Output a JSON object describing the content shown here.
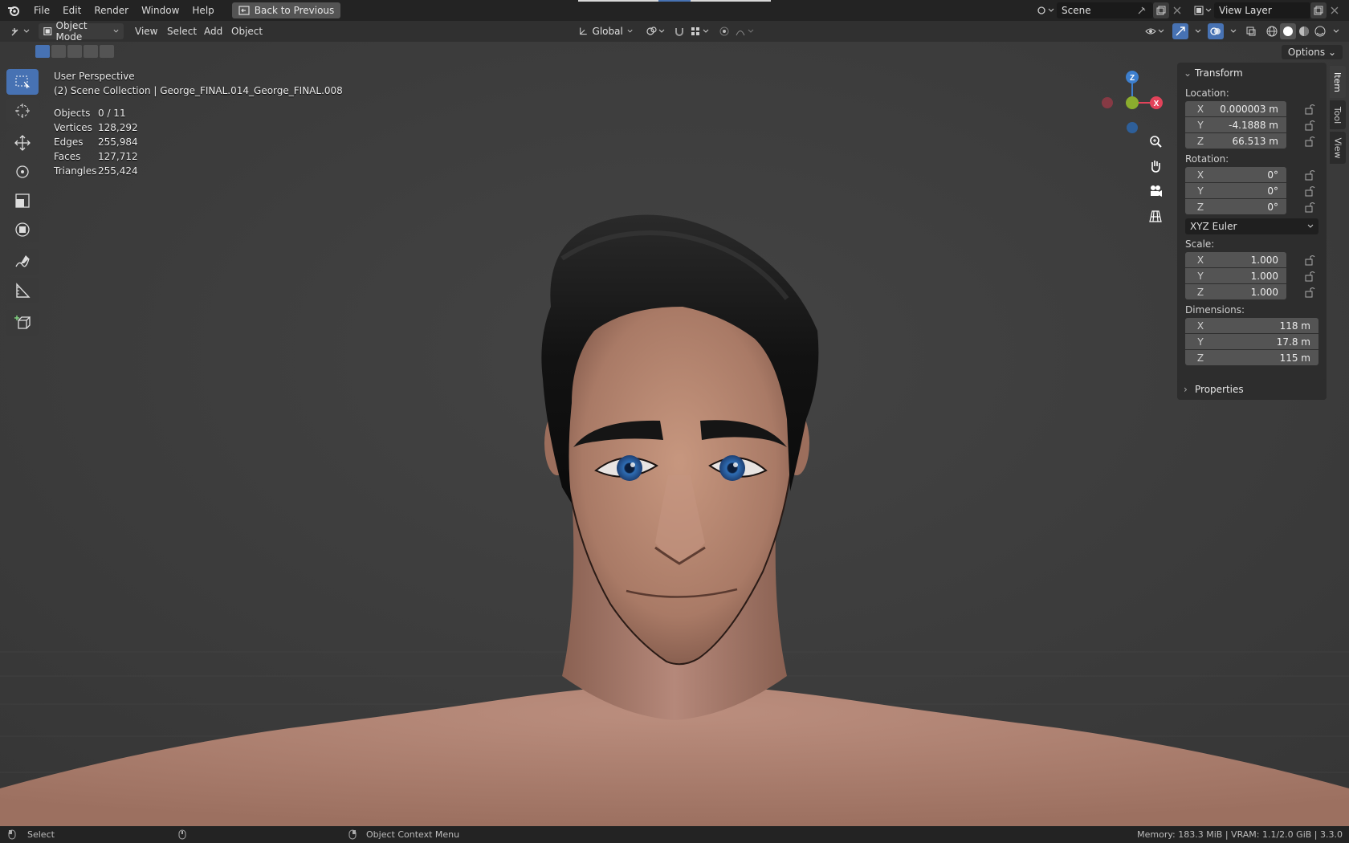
{
  "menubar": {
    "items": [
      "File",
      "Edit",
      "Render",
      "Window",
      "Help"
    ],
    "back_label": "Back to Previous",
    "scene_name": "Scene",
    "view_layer": "View Layer"
  },
  "header": {
    "mode": "Object Mode",
    "menus": [
      "View",
      "Select",
      "Add",
      "Object"
    ],
    "orientation": "Global",
    "options_label": "Options"
  },
  "overlay": {
    "perspective": "User Perspective",
    "collection": "(2) Scene Collection | George_FINAL.014_George_FINAL.008",
    "stats": [
      {
        "label": "Objects",
        "value": "0 / 11"
      },
      {
        "label": "Vertices",
        "value": "128,292"
      },
      {
        "label": "Edges",
        "value": "255,984"
      },
      {
        "label": "Faces",
        "value": "127,712"
      },
      {
        "label": "Triangles",
        "value": "255,424"
      }
    ]
  },
  "gizmo": {
    "x": "X",
    "y": "Y",
    "z": "Z"
  },
  "panel": {
    "title": "Transform",
    "location_label": "Location:",
    "location": [
      {
        "axis": "X",
        "value": "0.000003 m"
      },
      {
        "axis": "Y",
        "value": "-4.1888 m"
      },
      {
        "axis": "Z",
        "value": "66.513 m"
      }
    ],
    "rotation_label": "Rotation:",
    "rotation": [
      {
        "axis": "X",
        "value": "0°"
      },
      {
        "axis": "Y",
        "value": "0°"
      },
      {
        "axis": "Z",
        "value": "0°"
      }
    ],
    "rotation_mode": "XYZ Euler",
    "scale_label": "Scale:",
    "scale": [
      {
        "axis": "X",
        "value": "1.000"
      },
      {
        "axis": "Y",
        "value": "1.000"
      },
      {
        "axis": "Z",
        "value": "1.000"
      }
    ],
    "dimensions_label": "Dimensions:",
    "dimensions": [
      {
        "axis": "X",
        "value": "118 m"
      },
      {
        "axis": "Y",
        "value": "17.8 m"
      },
      {
        "axis": "Z",
        "value": "115 m"
      }
    ],
    "properties_label": "Properties"
  },
  "side_tabs": [
    "Item",
    "Tool",
    "View"
  ],
  "statusbar": {
    "select": "Select",
    "context_menu": "Object Context Menu",
    "info": "Memory: 183.3 MiB | VRAM: 1.1/2.0 GiB | 3.3.0"
  },
  "colors": {
    "accent": "#4772b3",
    "axis_x": "#e2435a",
    "axis_y": "#8bad2e",
    "axis_z": "#3d7fce"
  }
}
